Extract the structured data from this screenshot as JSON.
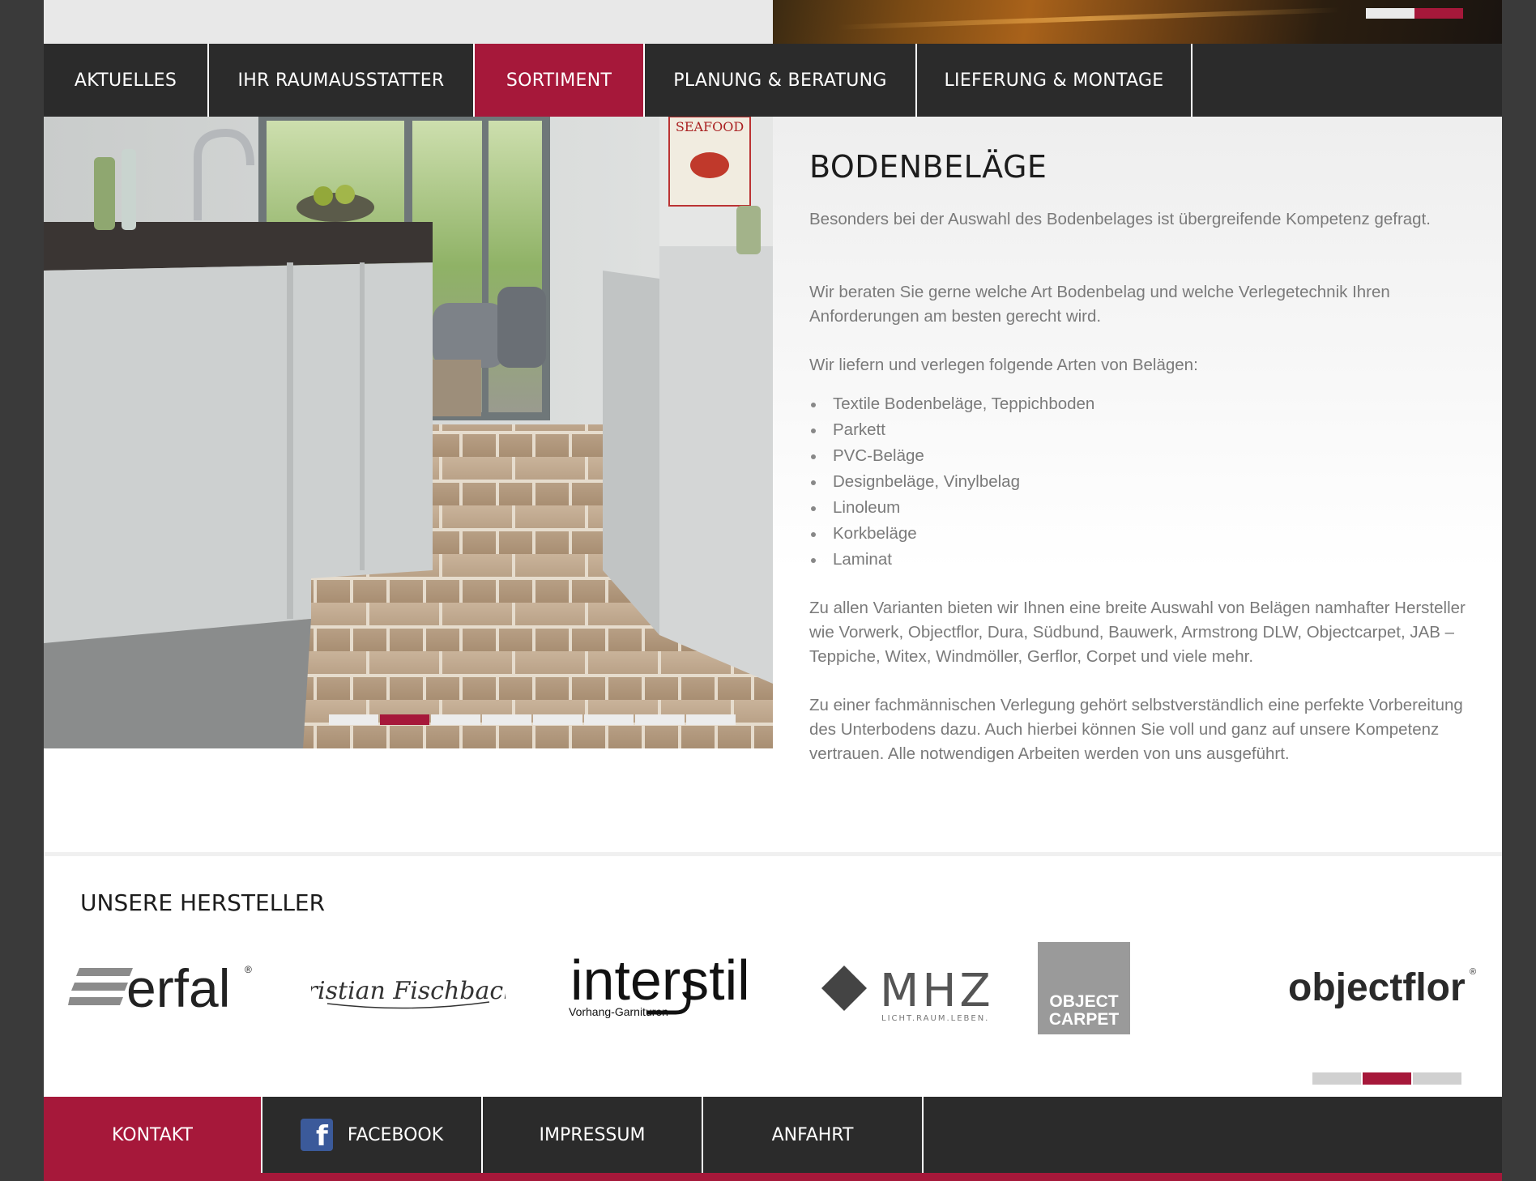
{
  "nav": {
    "items": [
      {
        "label": "AKTUELLES"
      },
      {
        "label": "IHR RAUMAUSSTATTER"
      },
      {
        "label": "SORTIMENT",
        "active": true
      },
      {
        "label": "PLANUNG & BERATUNG"
      },
      {
        "label": "LIEFERUNG & MONTAGE"
      }
    ]
  },
  "hero": {
    "sign_text": "SEAFOOD",
    "slide_count": 8,
    "active_slide": 2
  },
  "content": {
    "title": "BODENBELÄGE",
    "paragraph1": "Besonders bei der Auswahl des Bodenbelages ist übergreifende Kompetenz gefragt.",
    "paragraph2": "Wir beraten Sie gerne welche Art Bodenbelag und welche Verlegetechnik Ihren Anforderungen am besten gerecht wird.",
    "paragraph3": "Wir liefern und verlegen folgende Arten von Belägen:",
    "list": [
      "Textile Bodenbeläge, Teppichboden",
      "Parkett",
      "PVC-Beläge",
      "Designbeläge, Vinylbelag",
      "Linoleum",
      "Korkbeläge",
      "Laminat"
    ],
    "paragraph4": "Zu allen Varianten bieten wir Ihnen eine breite Auswahl von Belägen namhafter Hersteller wie Vorwerk, Objectflor, Dura, Südbund, Bauwerk, Armstrong DLW, Objectcarpet, JAB – Teppiche, Witex, Windmöller, Gerflor, Corpet und viele mehr.",
    "paragraph5": "Zu einer fachmännischen Verlegung gehört selbstverständlich eine perfekte Vorbereitung des Unterbodens dazu. Auch hierbei können Sie voll und ganz auf unsere Kompetenz vertrauen. Alle notwendigen Arbeiten werden von uns ausgeführt."
  },
  "manufacturers": {
    "title": "UNSERE HERSTELLER",
    "logos": {
      "erfal": "erfal",
      "erfal_mark": "®",
      "fischbacher": "Christian Fischbacher",
      "interstil": "interstil",
      "interstil_sub": "Vorhang-Garnituren",
      "mhz": "MHZ",
      "mhz_sub": "LICHT.RAUM.LEBEN.",
      "objectcarpet_1": "OBJECT",
      "objectcarpet_2": "CARPET",
      "objectflor": "objectflor",
      "objectflor_mark": "®"
    },
    "page_count": 3,
    "active_page": 2
  },
  "footer": {
    "kontakt": "KONTAKT",
    "facebook": "FACEBOOK",
    "facebook_glyph": "f",
    "impressum": "IMPRESSUM",
    "anfahrt": "ANFAHRT"
  },
  "colors": {
    "accent": "#a6183a",
    "nav_bg": "#2b2b2b",
    "text_gray": "#7a7a7a"
  }
}
